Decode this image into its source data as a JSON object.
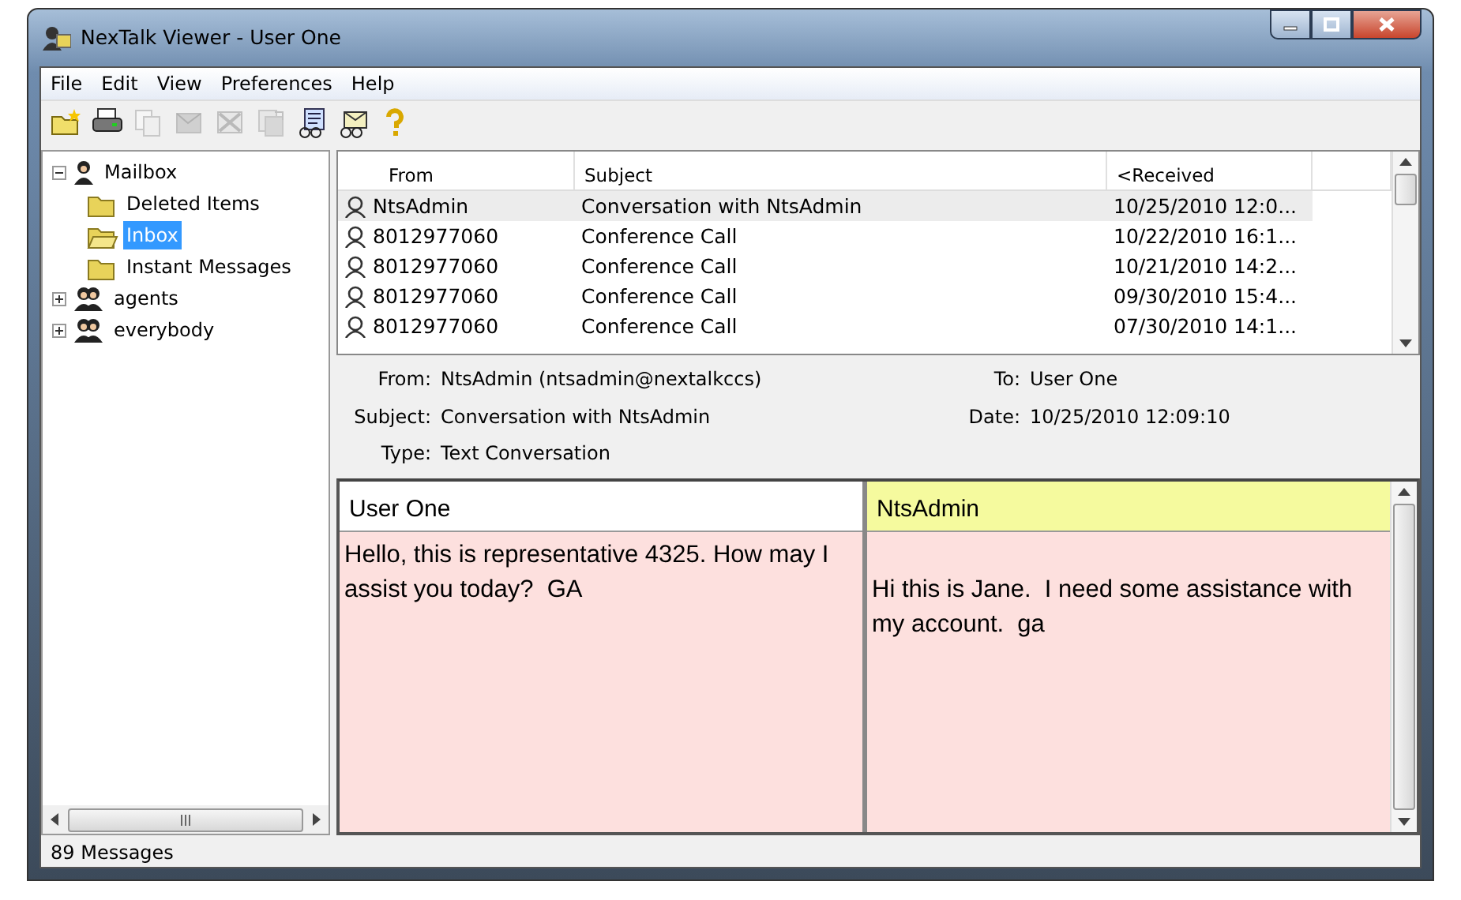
{
  "window": {
    "title": "NexTalk Viewer - User One"
  },
  "menu": [
    "File",
    "Edit",
    "View",
    "Preferences",
    "Help"
  ],
  "toolbar": [
    {
      "kind": "new-folder",
      "disabled": false
    },
    {
      "kind": "print",
      "disabled": false
    },
    {
      "kind": "copy",
      "disabled": true
    },
    {
      "kind": "delete",
      "disabled": true
    },
    {
      "kind": "purge",
      "disabled": true
    },
    {
      "kind": "forward",
      "disabled": true
    },
    {
      "kind": "read",
      "disabled": false
    },
    {
      "kind": "mail",
      "disabled": false
    },
    {
      "kind": "help",
      "disabled": false
    }
  ],
  "tree": [
    {
      "label": "Mailbox",
      "kind": "user",
      "expanded": true,
      "selected": false,
      "children": [
        {
          "label": "Deleted Items",
          "kind": "folder",
          "selected": false
        },
        {
          "label": "Inbox",
          "kind": "folder",
          "selected": true
        },
        {
          "label": "Instant Messages",
          "kind": "folder",
          "selected": false
        }
      ]
    },
    {
      "label": "agents",
      "kind": "group",
      "expanded": false,
      "selected": false
    },
    {
      "label": "everybody",
      "kind": "group",
      "expanded": false,
      "selected": false
    }
  ],
  "messages": {
    "columns": [
      "From",
      "Subject",
      "<Received"
    ],
    "rows": [
      {
        "from": "NtsAdmin",
        "subject": "Conversation with NtsAdmin",
        "received": "10/25/2010 12:0...",
        "selected": true
      },
      {
        "from": "8012977060",
        "subject": "Conference Call",
        "received": "10/22/2010 16:1...",
        "selected": false
      },
      {
        "from": "8012977060",
        "subject": "Conference Call",
        "received": "10/21/2010 14:2...",
        "selected": false
      },
      {
        "from": "8012977060",
        "subject": "Conference Call",
        "received": "09/30/2010 15:4...",
        "selected": false
      },
      {
        "from": "8012977060",
        "subject": "Conference Call",
        "received": "07/30/2010 14:1...",
        "selected": false
      }
    ]
  },
  "header": {
    "fields": [
      {
        "label": "From:",
        "value": "NtsAdmin (ntsadmin@nextalkccs)"
      },
      {
        "label": "To:",
        "value": "User One"
      },
      {
        "label": "Subject:",
        "value": "Conversation with NtsAdmin"
      },
      {
        "label": "Date:",
        "value": "10/25/2010 12:09:10"
      },
      {
        "label": "Type:",
        "value": "Text Conversation"
      }
    ]
  },
  "conversation": [
    {
      "name": "User One",
      "color": "#ffffff",
      "text": "Hello, this is representative 4325. How may I assist you today?  GA",
      "offset": false
    },
    {
      "name": "NtsAdmin",
      "color": "#f5fa9e",
      "text": "Hi this is Jane.  I need some assistance with my account.  ga",
      "offset": true
    }
  ],
  "status_bar": "89 Messages"
}
